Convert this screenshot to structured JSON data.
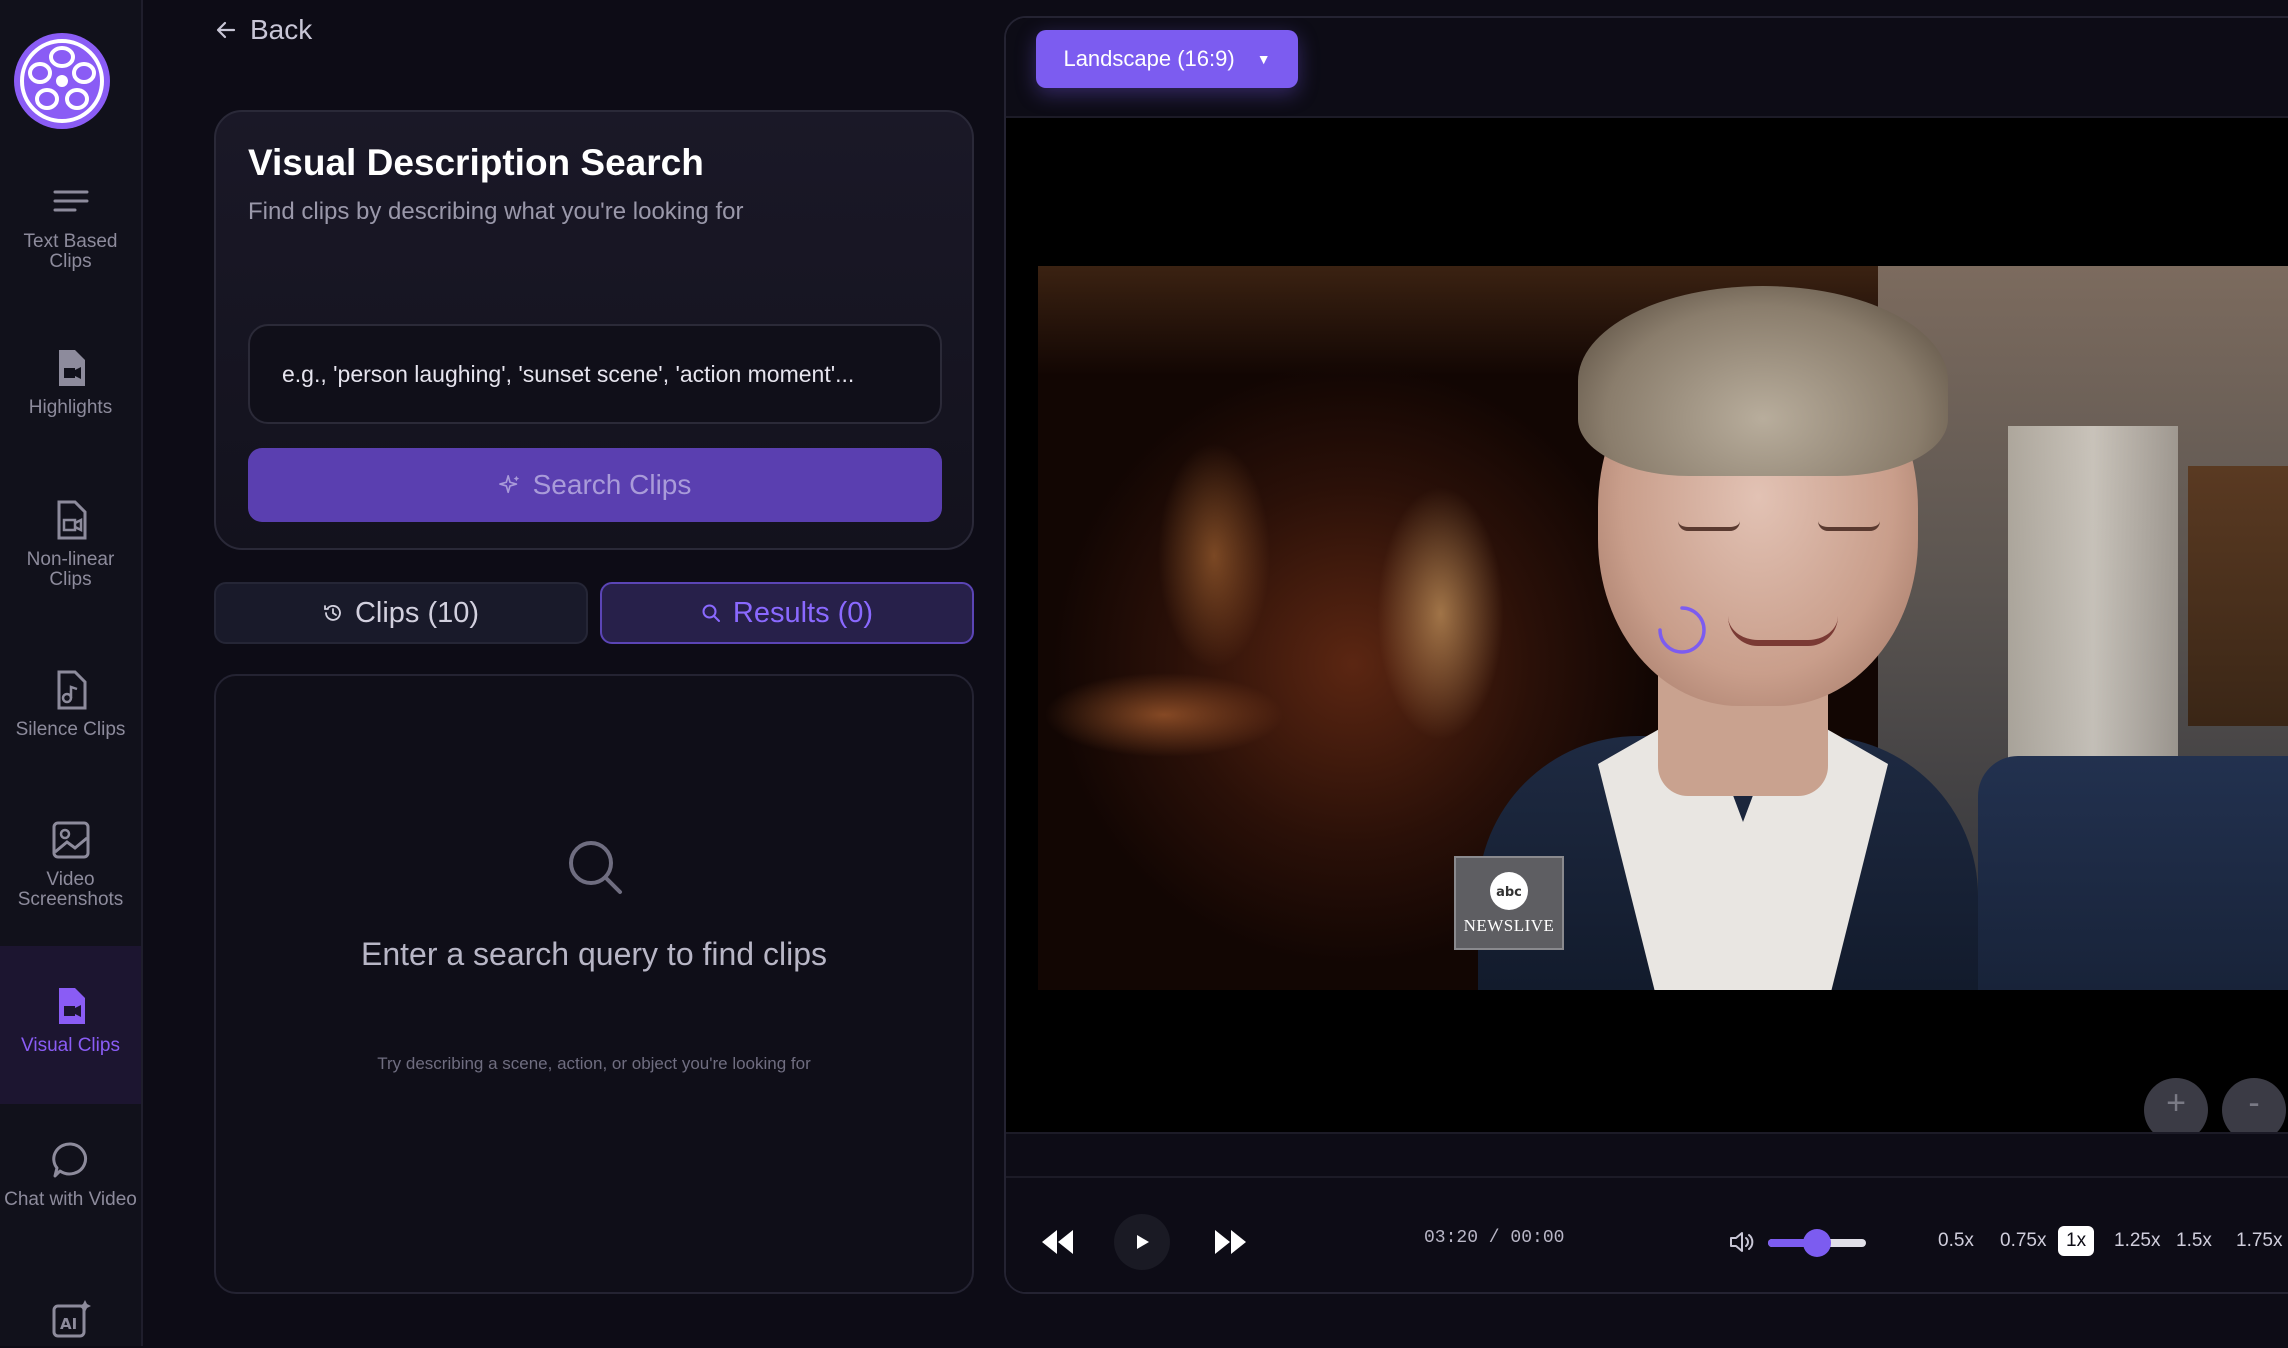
{
  "sidebar": {
    "items": [
      {
        "label": "Text Based Clips",
        "icon": "lines-icon"
      },
      {
        "label": "Highlights",
        "icon": "file-video-icon"
      },
      {
        "label": "Non-linear Clips",
        "icon": "file-video-outline-icon"
      },
      {
        "label": "Silence Clips",
        "icon": "file-audio-icon"
      },
      {
        "label": "Video Screenshots",
        "icon": "image-icon"
      },
      {
        "label": "Visual Clips",
        "icon": "file-video-icon",
        "active": true
      },
      {
        "label": "Chat with Video",
        "icon": "chat-bubble-icon"
      },
      {
        "label": "",
        "icon": "ai-sparkle-icon"
      }
    ]
  },
  "nav": {
    "back_label": "Back"
  },
  "search": {
    "title": "Visual Description Search",
    "subtitle": "Find clips by describing what you're looking for",
    "placeholder": "e.g., 'person laughing', 'sunset scene', 'action moment'...",
    "button_label": "Search Clips"
  },
  "tabs": {
    "clips_label": "Clips (10)",
    "results_label": "Results (0)"
  },
  "results": {
    "empty_title": "Enter a search query to find clips",
    "empty_hint": "Try describing a scene, action, or object you're looking for"
  },
  "player": {
    "aspect_label": "Landscape (16:9)",
    "caret": "▼",
    "watermark": "NEWSLIVE",
    "zoom_in": "+",
    "zoom_out": "-",
    "time": "03:20 / 00:00",
    "volume": 0.5,
    "speeds": [
      "0.5x",
      "0.75x",
      "1x",
      "1.25x",
      "1.5x",
      "1.75x"
    ],
    "active_speed": "1x"
  },
  "colors": {
    "accent": "#7c5cf0",
    "background": "#0d0c16",
    "sidebar_active_text": "#8a5cf5"
  }
}
